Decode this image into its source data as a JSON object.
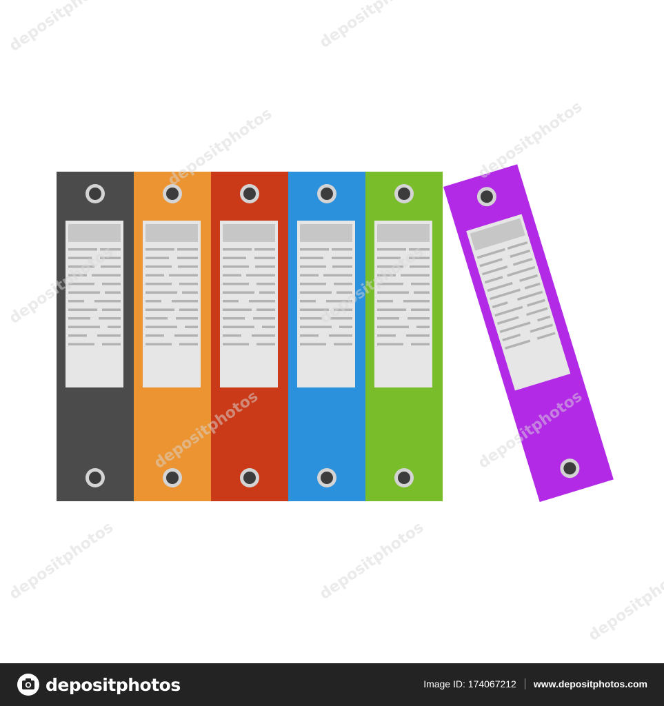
{
  "binders": [
    {
      "color": "#4b4b4b",
      "label_lines": 12
    },
    {
      "color": "#ec9431",
      "label_lines": 12
    },
    {
      "color": "#cb3a18",
      "label_lines": 12
    },
    {
      "color": "#2b91dc",
      "label_lines": 12
    },
    {
      "color": "#7abd2a",
      "label_lines": 12
    },
    {
      "color": "#b22ae6",
      "label_lines": 12,
      "tilted": true
    }
  ],
  "colors": {
    "label": "#e6e6e6",
    "label_header": "#c6c6c6",
    "label_text": "#b2b2b2",
    "ring_outer": "#d4d4d4",
    "ring_inner": "#3c3c3c",
    "watermark": "#d8d8d8",
    "footer_bg": "#232323"
  },
  "watermark_text": "depositphotos",
  "footer": {
    "brand": "depositphotos",
    "logo_icon": "camera-icon",
    "image_id": "Image ID: 174067212",
    "url": "www.depositphotos.com"
  }
}
